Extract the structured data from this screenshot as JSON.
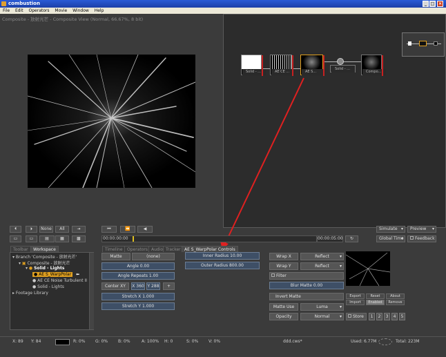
{
  "window": {
    "title": "combustion"
  },
  "menu": [
    "File",
    "Edit",
    "Operators",
    "Movie",
    "Window",
    "Help"
  ],
  "viewer": {
    "title": "Composite - 放射光芒 - Composite View (Normal, 66.67%, 8 bit)"
  },
  "schematic": {
    "nodes": [
      {
        "label": "Solid - ..."
      },
      {
        "label": "AE CE ..."
      },
      {
        "label": "AE S..."
      },
      {
        "label": "Solid - ..."
      },
      {
        "label": "Compo..."
      }
    ]
  },
  "transport": {
    "top_buttons": [
      "None",
      "All"
    ],
    "time_start": "00:00:00:00",
    "time_end": "00:00:05:00"
  },
  "right_controls": {
    "global_time": "Global Time",
    "feedback": "Feedback",
    "dropdown1": "Simulate",
    "dropdown2": "Preview"
  },
  "tabs": {
    "toolbar": "Toolbar",
    "workspace": "Workspace",
    "timeline": "Timeline",
    "operators": "Operators",
    "audio": "Audio",
    "tracker": "Tracker",
    "controls": "AE S_WarpPolar Controls"
  },
  "tree": {
    "branch": "Branch 'Composite - 放射光芒'",
    "composite": "Composite - 放射光芒",
    "solid_lights": "Solid - Lights",
    "warp": "AE S_WarpPolar",
    "noise": "AE CE Noise Turbulent II",
    "solid_lights2": "Solid - Lights",
    "footage": "Footage Library"
  },
  "controls": {
    "matte_label": "Matte",
    "matte_value": "(none)",
    "angle": "Angle 0.00",
    "angle_repeats": "Angle Repeats 1.00",
    "center_label": "Center XY",
    "center_x": "X 360",
    "center_y": "Y 288",
    "stretch_x": "Stretch X 1.000",
    "stretch_y": "Stretch Y 1.000",
    "inner_radius": "Inner Radius 10.00",
    "outer_radius": "Outer Radius 800.00"
  },
  "right_panel": {
    "wrap_x_label": "Wrap X",
    "wrap_x_value": "Reflect",
    "wrap_y_label": "Wrap Y",
    "wrap_y_value": "Reflect",
    "filter": "Filter",
    "blur_matte": "Blur Matte 0.00",
    "invert_matte": "Invert Matte",
    "matte_use_label": "Matte Use",
    "matte_use_value": "Luma",
    "opacity_label": "Opacity",
    "opacity_value": "Normal",
    "store": "Store",
    "store_slots": [
      "1",
      "2",
      "3",
      "4",
      "5"
    ],
    "export": "Export",
    "reset": "Reset",
    "about": "About",
    "import": "Import",
    "enabled": "Enabled",
    "remove": "Remove"
  },
  "status": {
    "x": "X:  89",
    "y": "Y:  84",
    "r": "R: 0%",
    "g": "G: 0%",
    "b": "B: 0%",
    "a": "A: 100%",
    "h": "H: 0",
    "s": "S: 0%",
    "v": "V: 0%",
    "file": "ddd.cws*",
    "used": "Used: 6.77M",
    "total": "Total: 223M"
  }
}
